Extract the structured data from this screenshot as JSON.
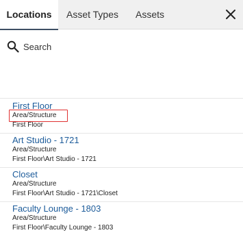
{
  "tabs": [
    {
      "label": "Locations",
      "active": true
    },
    {
      "label": "Asset Types",
      "active": false
    },
    {
      "label": "Assets",
      "active": false
    }
  ],
  "close_icon": "close-icon",
  "search": {
    "label": "Search",
    "icon": "search-icon"
  },
  "items": [
    {
      "title": "First Floor",
      "type": "Area/Structure",
      "path": "First Floor"
    },
    {
      "title": "Art Studio - 1721",
      "type": "Area/Structure",
      "path": "First Floor\\Art Studio - 1721"
    },
    {
      "title": "Closet",
      "type": "Area/Structure",
      "path": "First Floor\\Art Studio - 1721\\Closet"
    },
    {
      "title": "Faculty Lounge - 1803",
      "type": "Area/Structure",
      "path": "First Floor\\Faculty Lounge - 1803"
    }
  ],
  "colors": {
    "accent": "#3d4f64",
    "link": "#1c5b9a",
    "highlight": "#e03131",
    "tabbar_bg": "#f0f0f0"
  }
}
